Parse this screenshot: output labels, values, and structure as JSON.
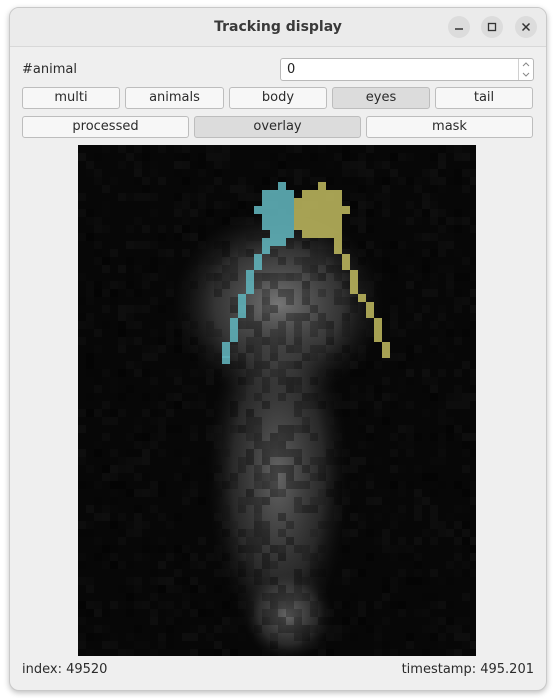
{
  "window": {
    "title": "Tracking display"
  },
  "animal_selector": {
    "label": "#animal",
    "value": "0"
  },
  "mode_buttons": [
    {
      "label": "multi",
      "active": false
    },
    {
      "label": "animals",
      "active": false
    },
    {
      "label": "body",
      "active": false
    },
    {
      "label": "eyes",
      "active": true
    },
    {
      "label": "tail",
      "active": false
    }
  ],
  "view_buttons": [
    {
      "label": "processed",
      "active": false
    },
    {
      "label": "overlay",
      "active": true
    },
    {
      "label": "mask",
      "active": false
    }
  ],
  "overlay_colors": {
    "left_eye": "#5fb0b8",
    "right_eye": "#b8b35c"
  },
  "status": {
    "index_label": "index:",
    "index_value": "49520",
    "timestamp_label": "timestamp:",
    "timestamp_value": "495.201"
  }
}
